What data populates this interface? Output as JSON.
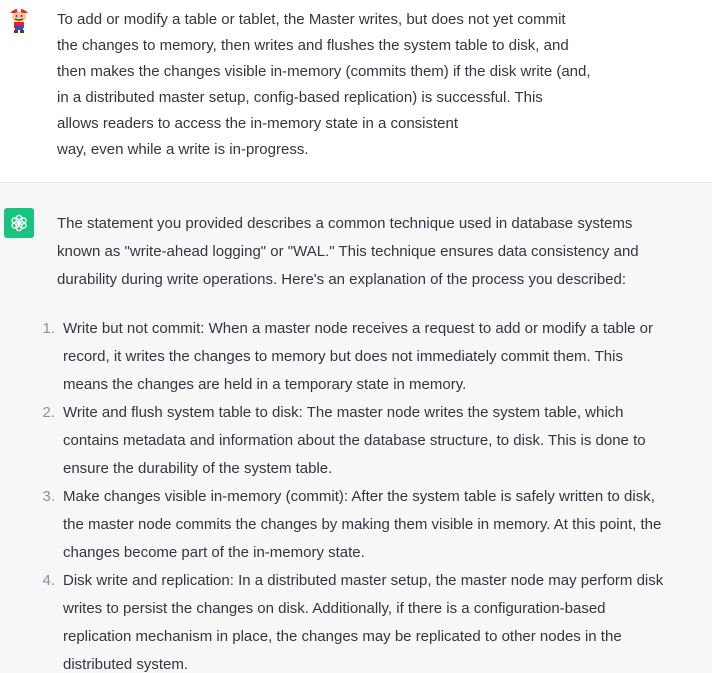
{
  "user_message": {
    "lines": [
      "To add or modify a table or tablet, the Master writes, but does not yet commit",
      "the changes to memory, then writes and flushes the system table to disk, and",
      "then makes the changes visible in-memory (commits them) if the disk write (and,",
      "in a distributed master setup, config-based replication) is successful. This",
      "allows readers to access the in-memory state in a consistent",
      "way, even while a write is in-progress."
    ]
  },
  "assistant_message": {
    "intro_lines": [
      "The statement you provided describes a common technique used in database systems",
      "known as \"write-ahead logging\" or \"WAL.\" This technique ensures data consistency and",
      "durability during write operations. Here's an explanation of the process you described:"
    ],
    "list": [
      {
        "number": "1.",
        "lines": [
          "Write but not commit: When a master node receives a request to add or modify a table or",
          "record, it writes the changes to memory but does not immediately commit them. This",
          "means the changes are held in a temporary state in memory."
        ]
      },
      {
        "number": "2.",
        "lines": [
          "Write and flush system table to disk: The master node writes the system table, which",
          "contains metadata and information about the database structure, to disk. This is done to",
          "ensure the durability of the system table."
        ]
      },
      {
        "number": "3.",
        "lines": [
          "Make changes visible in-memory (commit): After the system table is safely written to disk,",
          "the master node commits the changes by making them visible in memory. At this point, the",
          "changes become part of the in-memory state."
        ]
      },
      {
        "number": "4.",
        "lines": [
          "Disk write and replication: In a distributed master setup, the master node may perform disk",
          "writes to persist the changes on disk. Additionally, if there is a configuration-based",
          "replication mechanism in place, the changes may be replicated to other nodes in the",
          "distributed system."
        ]
      }
    ]
  },
  "colors": {
    "text": "#343541",
    "assistant_bg": "#f7f7f8",
    "bot_avatar_bg": "#19c37d",
    "list_number": "#8e8ea0"
  },
  "icons": {
    "user_avatar": "mario-avatar-icon",
    "assistant_avatar": "openai-logo-icon"
  }
}
